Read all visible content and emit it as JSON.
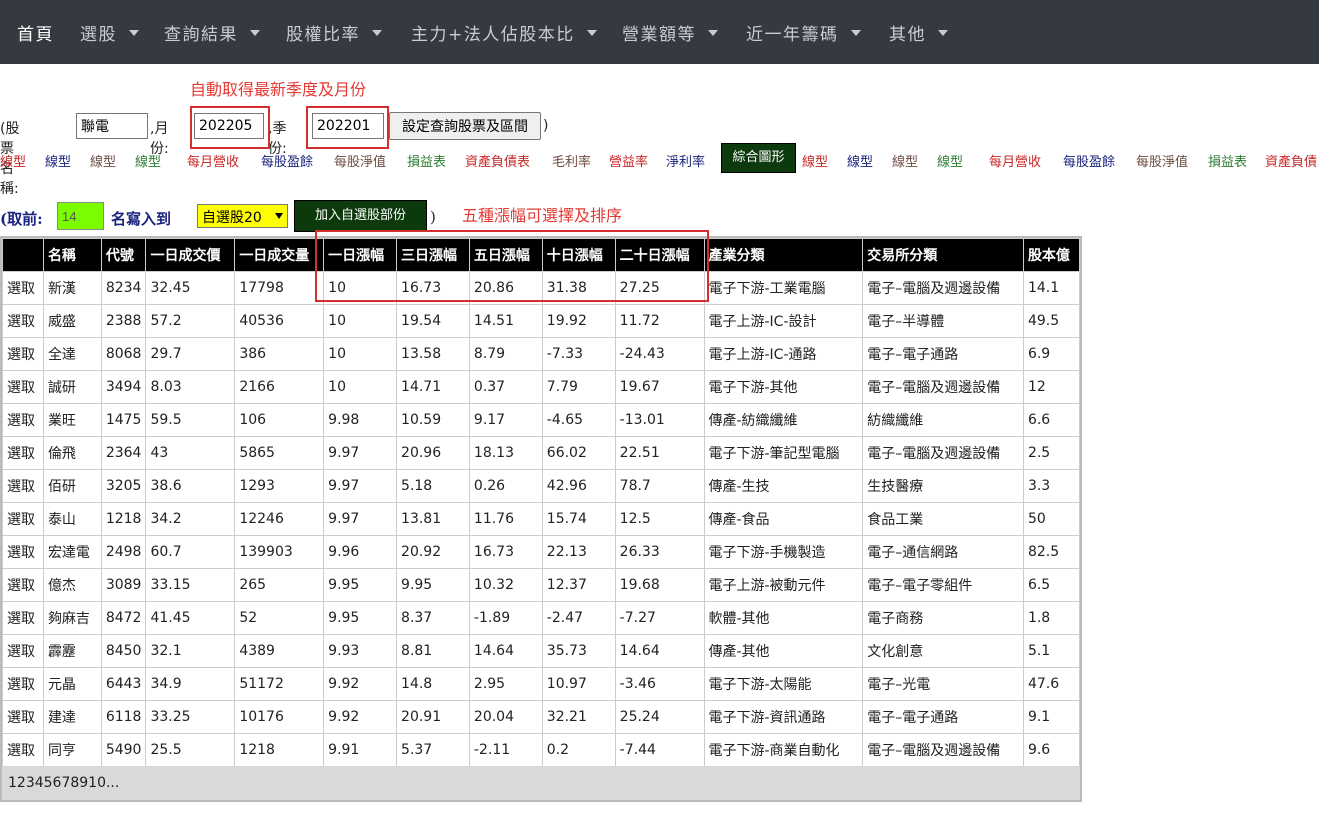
{
  "nav": {
    "home": "首頁",
    "items": [
      "選股",
      "查詢結果",
      "股權比率",
      "主力+法人佔股本比",
      "營業額等",
      "近一年籌碼",
      "其他"
    ]
  },
  "annotations": {
    "auto_fetch": "自動取得最新季度及月份",
    "five_gains": "五種漲幅可選擇及排序"
  },
  "form": {
    "stock_label": "(股票名稱:",
    "stock_value": "聯電",
    "month_label": ",月份:",
    "month_value": "202205",
    "season_label": ",季份:",
    "season_value": "202201",
    "set_button": "設定查詢股票及區間",
    "close_paren": ")"
  },
  "links": [
    {
      "text": "線型",
      "color": "#c62828"
    },
    {
      "text": "線型",
      "color": "#1a237e"
    },
    {
      "text": "線型",
      "color": "#6d4c41"
    },
    {
      "text": "線型",
      "color": "#2e7d32"
    },
    {
      "text": "每月營收",
      "color": "#c62828"
    },
    {
      "text": "每股盈餘",
      "color": "#1a237e"
    },
    {
      "text": "每股淨值",
      "color": "#6d4c41"
    },
    {
      "text": "損益表",
      "color": "#2e7d32"
    },
    {
      "text": "資產負債表",
      "color": "#c62828"
    },
    {
      "text": "毛利率",
      "color": "#6d4c41"
    },
    {
      "text": "營益率",
      "color": "#c62828"
    },
    {
      "text": "淨利率",
      "color": "#1a237e"
    }
  ],
  "links2": [
    {
      "text": "線型",
      "color": "#c62828"
    },
    {
      "text": "線型",
      "color": "#1a237e"
    },
    {
      "text": "線型",
      "color": "#6d4c41"
    },
    {
      "text": "線型",
      "color": "#2e7d32"
    },
    {
      "text": "每月營收",
      "color": "#c62828"
    },
    {
      "text": "每股盈餘",
      "color": "#1a237e"
    },
    {
      "text": "每股淨值",
      "color": "#6d4c41"
    },
    {
      "text": "損益表",
      "color": "#2e7d32"
    },
    {
      "text": "資產負債",
      "color": "#c62828"
    }
  ],
  "combo_button": "綜合圖形",
  "pick": {
    "prefix": "(取前:",
    "count": "14",
    "suffix": "名寫入到",
    "select_value": "自選股20",
    "add_button": "加入自選股部份",
    "close_paren": ")"
  },
  "table": {
    "headers": [
      "",
      "名稱",
      "代號",
      "一日成交價",
      "一日成交量",
      "一日漲幅",
      "三日漲幅",
      "五日漲幅",
      "十日漲幅",
      "二十日漲幅",
      "產業分類",
      "交易所分類",
      "股本億"
    ],
    "select_label": "選取",
    "rows": [
      [
        "新漢",
        "8234",
        "32.45",
        "17798",
        "10",
        "16.73",
        "20.86",
        "31.38",
        "27.25",
        "電子下游-工業電腦",
        "電子–電腦及週邊設備",
        "14.1"
      ],
      [
        "威盛",
        "2388",
        "57.2",
        "40536",
        "10",
        "19.54",
        "14.51",
        "19.92",
        "11.72",
        "電子上游-IC-設計",
        "電子–半導體",
        "49.5"
      ],
      [
        "全達",
        "8068",
        "29.7",
        "386",
        "10",
        "13.58",
        "8.79",
        "-7.33",
        "-24.43",
        "電子上游-IC-通路",
        "電子–電子通路",
        "6.9"
      ],
      [
        "誠研",
        "3494",
        "8.03",
        "2166",
        "10",
        "14.71",
        "0.37",
        "7.79",
        "19.67",
        "電子下游-其他",
        "電子–電腦及週邊設備",
        "12"
      ],
      [
        "業旺",
        "1475",
        "59.5",
        "106",
        "9.98",
        "10.59",
        "9.17",
        "-4.65",
        "-13.01",
        "傳產-紡織纖維",
        "紡織纖維",
        "6.6"
      ],
      [
        "倫飛",
        "2364",
        "43",
        "5865",
        "9.97",
        "20.96",
        "18.13",
        "66.02",
        "22.51",
        "電子下游-筆記型電腦",
        "電子–電腦及週邊設備",
        "2.5"
      ],
      [
        "佰研",
        "3205",
        "38.6",
        "1293",
        "9.97",
        "5.18",
        "0.26",
        "42.96",
        "78.7",
        "傳產-生技",
        "生技醫療",
        "3.3"
      ],
      [
        "泰山",
        "1218",
        "34.2",
        "12246",
        "9.97",
        "13.81",
        "11.76",
        "15.74",
        "12.5",
        "傳產-食品",
        "食品工業",
        "50"
      ],
      [
        "宏達電",
        "2498",
        "60.7",
        "139903",
        "9.96",
        "20.92",
        "16.73",
        "22.13",
        "26.33",
        "電子下游-手機製造",
        "電子–通信網路",
        "82.5"
      ],
      [
        "億杰",
        "3089",
        "33.15",
        "265",
        "9.95",
        "9.95",
        "10.32",
        "12.37",
        "19.68",
        "電子上游-被動元件",
        "電子–電子零組件",
        "6.5"
      ],
      [
        "夠麻吉",
        "8472",
        "41.45",
        "52",
        "9.95",
        "8.37",
        "-1.89",
        "-2.47",
        "-7.27",
        "軟體-其他",
        "電子商務",
        "1.8"
      ],
      [
        "霹靂",
        "8450",
        "32.1",
        "4389",
        "9.93",
        "8.81",
        "14.64",
        "35.73",
        "14.64",
        "傳產-其他",
        "文化創意",
        "5.1"
      ],
      [
        "元晶",
        "6443",
        "34.9",
        "51172",
        "9.92",
        "14.8",
        "2.95",
        "10.97",
        "-3.46",
        "電子下游-太陽能",
        "電子–光電",
        "47.6"
      ],
      [
        "建達",
        "6118",
        "33.25",
        "10176",
        "9.92",
        "20.91",
        "20.04",
        "32.21",
        "25.24",
        "電子下游-資訊通路",
        "電子–電子通路",
        "9.1"
      ],
      [
        "同亨",
        "5490",
        "25.5",
        "1218",
        "9.91",
        "5.37",
        "-2.11",
        "0.2",
        "-7.44",
        "電子下游-商業自動化",
        "電子–電腦及週邊設備",
        "9.6"
      ]
    ]
  },
  "pager": "12345678910..."
}
